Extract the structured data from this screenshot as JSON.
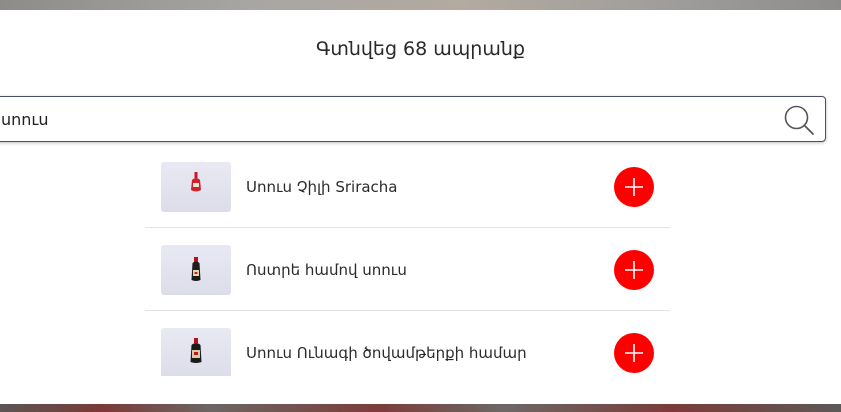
{
  "modal": {
    "title": "Գտնվեց 68 ապրանք"
  },
  "search": {
    "value": "սոուս"
  },
  "products": [
    {
      "name": "Սոուս Չիլի Sriracha"
    },
    {
      "name": "Ոստրե համով սոուս"
    },
    {
      "name": "Սոուս Ունագի ծովամթերքի համար"
    }
  ],
  "icons": {
    "search": "search-icon",
    "add": "plus-icon"
  },
  "colors": {
    "add_button": "#ff0000"
  }
}
